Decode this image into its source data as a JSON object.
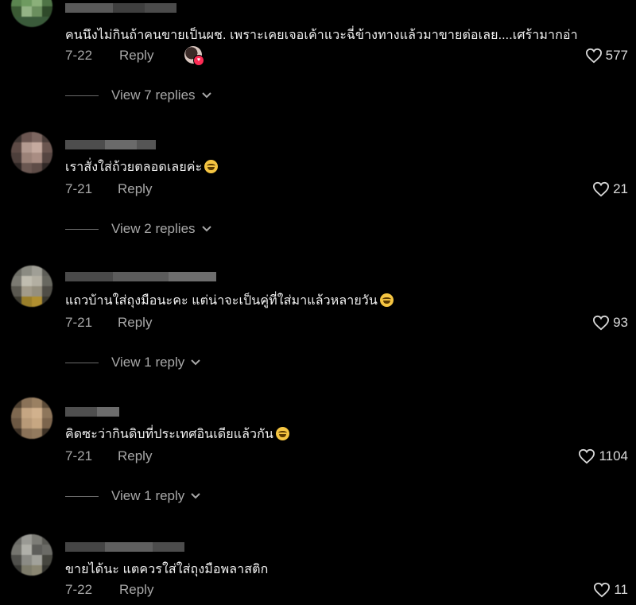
{
  "reply_label": "Reply",
  "comments": [
    {
      "text": "คนนึงไม่กินถ้าคนขายเป็นผช. เพราะเคยเจอเค้าแวะฉี่ข้างทางแล้วมาขายต่อเลย....เศร้ามากอ่า",
      "date": "7-22",
      "likes": "577",
      "view_replies": "View 7 replies",
      "emoji": null,
      "creator_liked": true
    },
    {
      "text": "เราสั่งใส่ถ้วยตลอดเลยค่ะ",
      "date": "7-21",
      "likes": "21",
      "view_replies": "View 2 replies",
      "emoji": "grinning-sweat-emoji"
    },
    {
      "text": "แถวบ้านใส่ถุงมือนะคะ แต่น่าจะเป็นคู่ที่ใส่มาแล้วหลายวัน",
      "date": "7-21",
      "likes": "93",
      "view_replies": "View 1 reply",
      "emoji": "grinning-sweat-emoji"
    },
    {
      "text": "คิดซะว่ากินดิบที่ประเทศอินเดียแล้วกัน",
      "date": "7-21",
      "likes": "1104",
      "view_replies": "View 1 reply",
      "emoji": "tears-of-joy-emoji"
    },
    {
      "text": "ขายได้นะ แตควรใส่ใส่ถุงมือพลาสติก",
      "date": "7-22",
      "likes": "11",
      "view_replies": null,
      "emoji": null
    }
  ],
  "colors": {
    "background": "#000000",
    "text": "#f2f2f2",
    "muted": "#a8a8a8",
    "badge_heart": "#fe2c55"
  }
}
